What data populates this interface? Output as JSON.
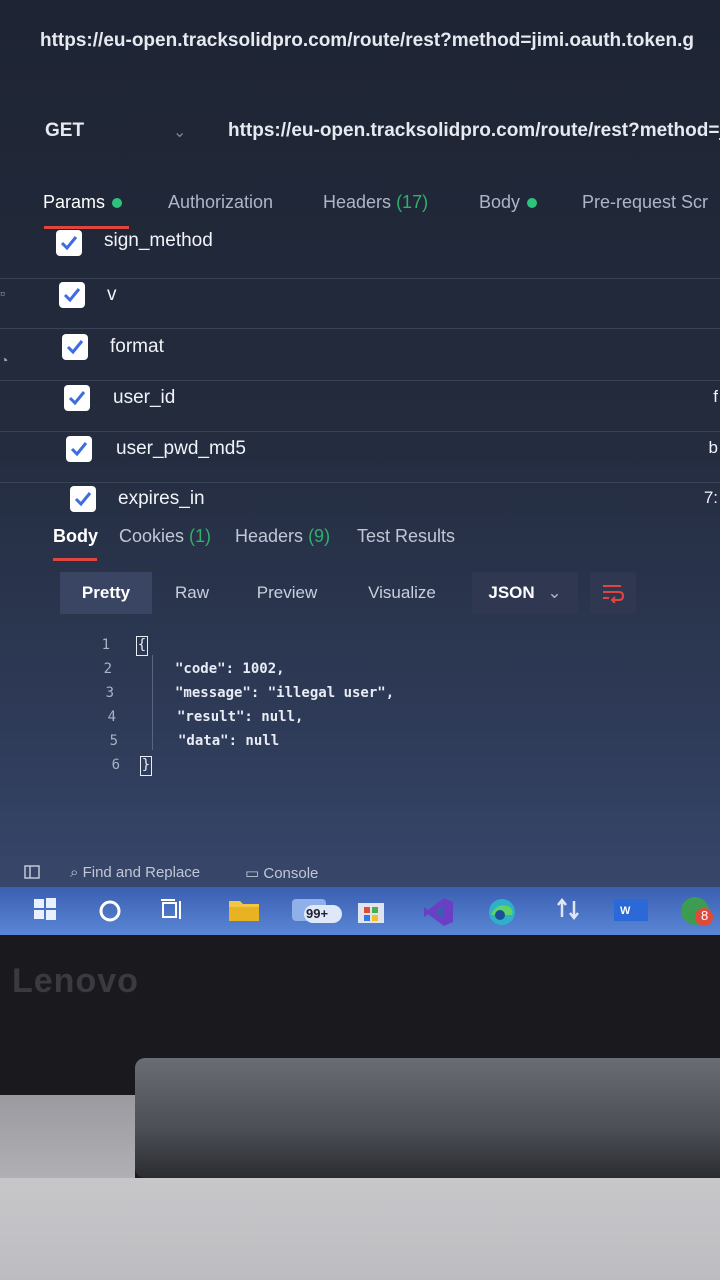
{
  "top_url": "https://eu-open.tracksolidpro.com/route/rest?method=jimi.oauth.token.g",
  "request": {
    "method": "GET",
    "url": "https://eu-open.tracksolidpro.com/route/rest?method=j"
  },
  "request_tabs": {
    "params": "Params",
    "authorization": "Authorization",
    "headers": "Headers",
    "headers_count": "(17)",
    "body": "Body",
    "prerequest": "Pre-request Scr"
  },
  "params": [
    {
      "name": "sign_method",
      "value": ""
    },
    {
      "name": "v",
      "value": ""
    },
    {
      "name": "format",
      "value": ""
    },
    {
      "name": "user_id",
      "value": "f"
    },
    {
      "name": "user_pwd_md5",
      "value": "b"
    },
    {
      "name": "expires_in",
      "value": "7:"
    }
  ],
  "response_tabs": {
    "body": "Body",
    "cookies": "Cookies",
    "cookies_count": "(1)",
    "headers": "Headers",
    "headers_count": "(9)",
    "tests": "Test Results"
  },
  "view_modes": {
    "pretty": "Pretty",
    "raw": "Raw",
    "preview": "Preview",
    "visualize": "Visualize",
    "format": "JSON"
  },
  "code_lines": [
    {
      "n": "1",
      "text": ""
    },
    {
      "n": "2",
      "text": "\"code\": 1002,"
    },
    {
      "n": "3",
      "text": "\"message\": \"illegal user\","
    },
    {
      "n": "4",
      "text": "\"result\": null,"
    },
    {
      "n": "5",
      "text": "\"data\": null"
    },
    {
      "n": "6",
      "text": ""
    }
  ],
  "braces": {
    "open": "{",
    "close": "}"
  },
  "status_bar": {
    "find_replace": "Find and Replace",
    "console": "Console"
  },
  "taskbar": {
    "badge_count": "99+",
    "mail_badge": "8"
  },
  "brand": "Lenovo",
  "colors": {
    "accent": "#e0453f",
    "status_green": "#2ec27e",
    "taskbar": "#4a72c4"
  }
}
